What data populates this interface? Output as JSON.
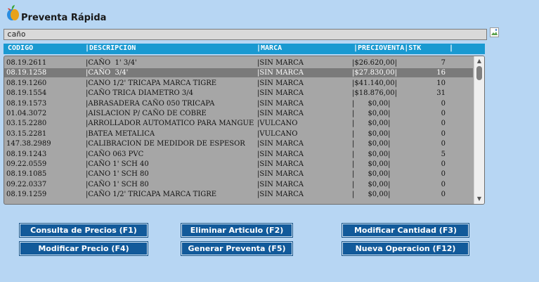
{
  "app": {
    "title": "Preventa Rápida"
  },
  "search": {
    "value": "caño"
  },
  "grid": {
    "headers": [
      "CODIGO",
      "|DESCRIPCION",
      "|MARCA",
      "|PRECIOVENTA|STK",
      "|"
    ],
    "rows": [
      {
        "code": "08.19.2611",
        "desc": "|CAÑO  1' 3/4'",
        "marca": "|SIN MARCA",
        "precio": "|$26.620,00|",
        "stk": "7"
      },
      {
        "code": "08.19.1258",
        "desc": "|CAÑO  3/4'",
        "marca": "|SIN MARCA",
        "precio": "|$27.830,00|",
        "stk": "16",
        "selected": true
      },
      {
        "code": "08.19.1260",
        "desc": "|CANO 1/2' TRICAPA MARCA TIGRE",
        "marca": "|SIN MARCA",
        "precio": "|$41.140,00|",
        "stk": "10"
      },
      {
        "code": "08.19.1554",
        "desc": "|CAÑO TRICA DIAMETRO 3/4",
        "marca": "|SIN MARCA",
        "precio": "|$18.876,00|",
        "stk": "31"
      },
      {
        "code": "08.19.1573",
        "desc": "|ABRASADERA CAÑO 050 TRICAPA",
        "marca": "|SIN MARCA",
        "precio": "|      $0,00|",
        "stk": "0"
      },
      {
        "code": "01.04.3072",
        "desc": "|AISLACION P/ CAÑO DE COBRE",
        "marca": "|SIN MARCA",
        "precio": "|      $0,00|",
        "stk": "0"
      },
      {
        "code": "03.15.2280",
        "desc": "|ARROLLADOR AUTOMATICO PARA MANGUE",
        "marca": "|VULCANO",
        "precio": "|      $0,00|",
        "stk": "0"
      },
      {
        "code": "03.15.2281",
        "desc": "|BATEA METALICA",
        "marca": "|VULCANO",
        "precio": "|      $0,00|",
        "stk": "0"
      },
      {
        "code": "147.38.2989",
        "desc": "|CALIBRACION DE MEDIDOR DE ESPESOR",
        "marca": "|SIN MARCA",
        "precio": "|      $0,00|",
        "stk": "0"
      },
      {
        "code": "08.19.1243",
        "desc": "|CAÑO 063 PVC",
        "marca": "|SIN MARCA",
        "precio": "|      $0,00|",
        "stk": "5"
      },
      {
        "code": "09.22.0559",
        "desc": "|CAÑO 1' SCH 40",
        "marca": "|SIN MARCA",
        "precio": "|      $0,00|",
        "stk": "0"
      },
      {
        "code": "08.19.1085",
        "desc": "|CANO 1' SCH 80",
        "marca": "|SIN MARCA",
        "precio": "|      $0,00|",
        "stk": "0"
      },
      {
        "code": "09.22.0337",
        "desc": "|CAÑO 1' SCH 80",
        "marca": "|SIN MARCA",
        "precio": "|      $0,00|",
        "stk": "0"
      },
      {
        "code": "08.19.1259",
        "desc": "|CAÑO 1/2' TRICAPA MARCA TIGRE",
        "marca": "|SIN MARCA",
        "precio": "|      $0,00|",
        "stk": "0"
      }
    ]
  },
  "buttons": {
    "consulta": "Consulta de Precios (F1)",
    "eliminar": "Eliminar Articulo (F2)",
    "modificar_cantidad": "Modificar Cantidad (F3)",
    "modificar_precio": "Modificar Precio (F4)",
    "generar": "Generar Preventa (F5)",
    "nueva": "Nueva Operacion (F12)"
  },
  "icons": {
    "app": "app-logo-icon",
    "broken_image": "broken-image-icon",
    "scroll_up": "scroll-up-arrow-icon",
    "scroll_down": "scroll-down-arrow-icon"
  },
  "colors": {
    "background": "#b7d6f3",
    "header": "#1999d1",
    "button": "#125a9a",
    "list": "#a6a6a6",
    "selected": "#7a7a7a"
  }
}
